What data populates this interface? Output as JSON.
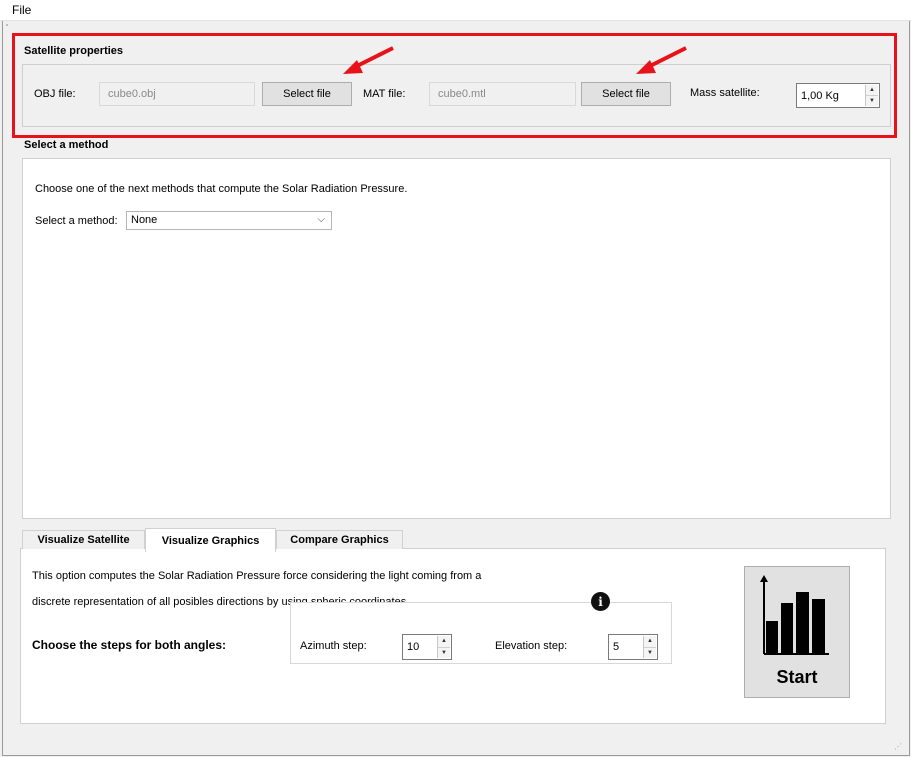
{
  "menu": {
    "file_label": "File"
  },
  "satellite": {
    "title": "Satellite properties",
    "obj_label": "OBJ file:",
    "obj_value": "cube0.obj",
    "obj_button": "Select file",
    "mat_label": "MAT file:",
    "mat_value": "cube0.mtl",
    "mat_button": "Select file",
    "mass_label": "Mass satellite:",
    "mass_value": "1,00 Kg"
  },
  "method": {
    "title": "Select a method",
    "description": "Choose one of the next methods that compute the Solar Radiation Pressure.",
    "select_label": "Select a method:",
    "select_value": "None"
  },
  "tabs": [
    {
      "label": "Visualize Satellite"
    },
    {
      "label": "Visualize Graphics"
    },
    {
      "label": "Compare Graphics"
    }
  ],
  "graphics": {
    "description_line1": "This option computes the Solar Radiation Pressure force considering the light coming from a",
    "description_line2": "discrete representation of all posibles directions by using spheric coordinates.",
    "steps_label": "Choose the steps for both angles:",
    "azimuth_label": "Azimuth step:",
    "azimuth_value": "10",
    "elevation_label": "Elevation step:",
    "elevation_value": "5",
    "info_glyph": "i",
    "start_label": "Start"
  },
  "colors": {
    "highlight": "#e8131a"
  }
}
